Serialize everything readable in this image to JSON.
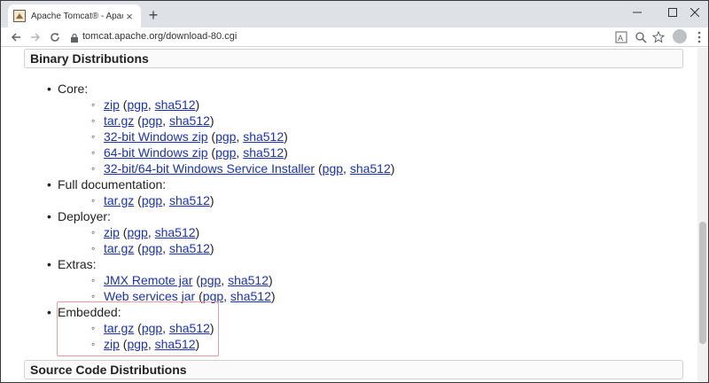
{
  "browser": {
    "tab_title": "Apache Tomcat® - Apache To",
    "tab_close_glyph": "×",
    "new_tab_glyph": "+",
    "url": "tomcat.apache.org/download-80.cgi",
    "icons": {
      "back": "back-arrow-icon",
      "forward": "forward-arrow-icon",
      "reload": "reload-icon",
      "lock": "lock-icon",
      "translate": "translate-icon",
      "zoom": "zoom-icon",
      "star": "star-icon",
      "avatar": "account-avatar",
      "menu": "kebab-menu-icon"
    }
  },
  "page": {
    "binary_header": "Binary Distributions",
    "source_header": "Source Code Distributions",
    "groups": {
      "core": {
        "label": "Core:",
        "items": [
          {
            "name": "zip",
            "pgp": "pgp",
            "sha": "sha512"
          },
          {
            "name": "tar.gz",
            "pgp": "pgp",
            "sha": "sha512"
          },
          {
            "name": "32-bit Windows zip",
            "pgp": "pgp",
            "sha": "sha512"
          },
          {
            "name": "64-bit Windows zip",
            "pgp": "pgp",
            "sha": "sha512"
          },
          {
            "name": "32-bit/64-bit Windows Service Installer",
            "pgp": "pgp",
            "sha": "sha512"
          }
        ]
      },
      "fulldoc": {
        "label": "Full documentation:",
        "items": [
          {
            "name": "tar.gz",
            "pgp": "pgp",
            "sha": "sha512"
          }
        ]
      },
      "deployer": {
        "label": "Deployer:",
        "items": [
          {
            "name": "zip",
            "pgp": "pgp",
            "sha": "sha512"
          },
          {
            "name": "tar.gz",
            "pgp": "pgp",
            "sha": "sha512"
          }
        ]
      },
      "extras": {
        "label": "Extras:",
        "items": [
          {
            "name": "JMX Remote jar",
            "pgp": "pgp",
            "sha": "sha512"
          },
          {
            "name": "Web services jar",
            "pgp": "pgp",
            "sha": "sha512"
          }
        ]
      },
      "embedded": {
        "label": "Embedded:",
        "items": [
          {
            "name": "tar.gz",
            "pgp": "pgp",
            "sha": "sha512"
          },
          {
            "name": "zip",
            "pgp": "pgp",
            "sha": "sha512"
          }
        ]
      }
    }
  },
  "colors": {
    "link": "#1a32b8",
    "highlight_border": "#e89aa3",
    "tabstrip_bg": "#dee1e6"
  }
}
